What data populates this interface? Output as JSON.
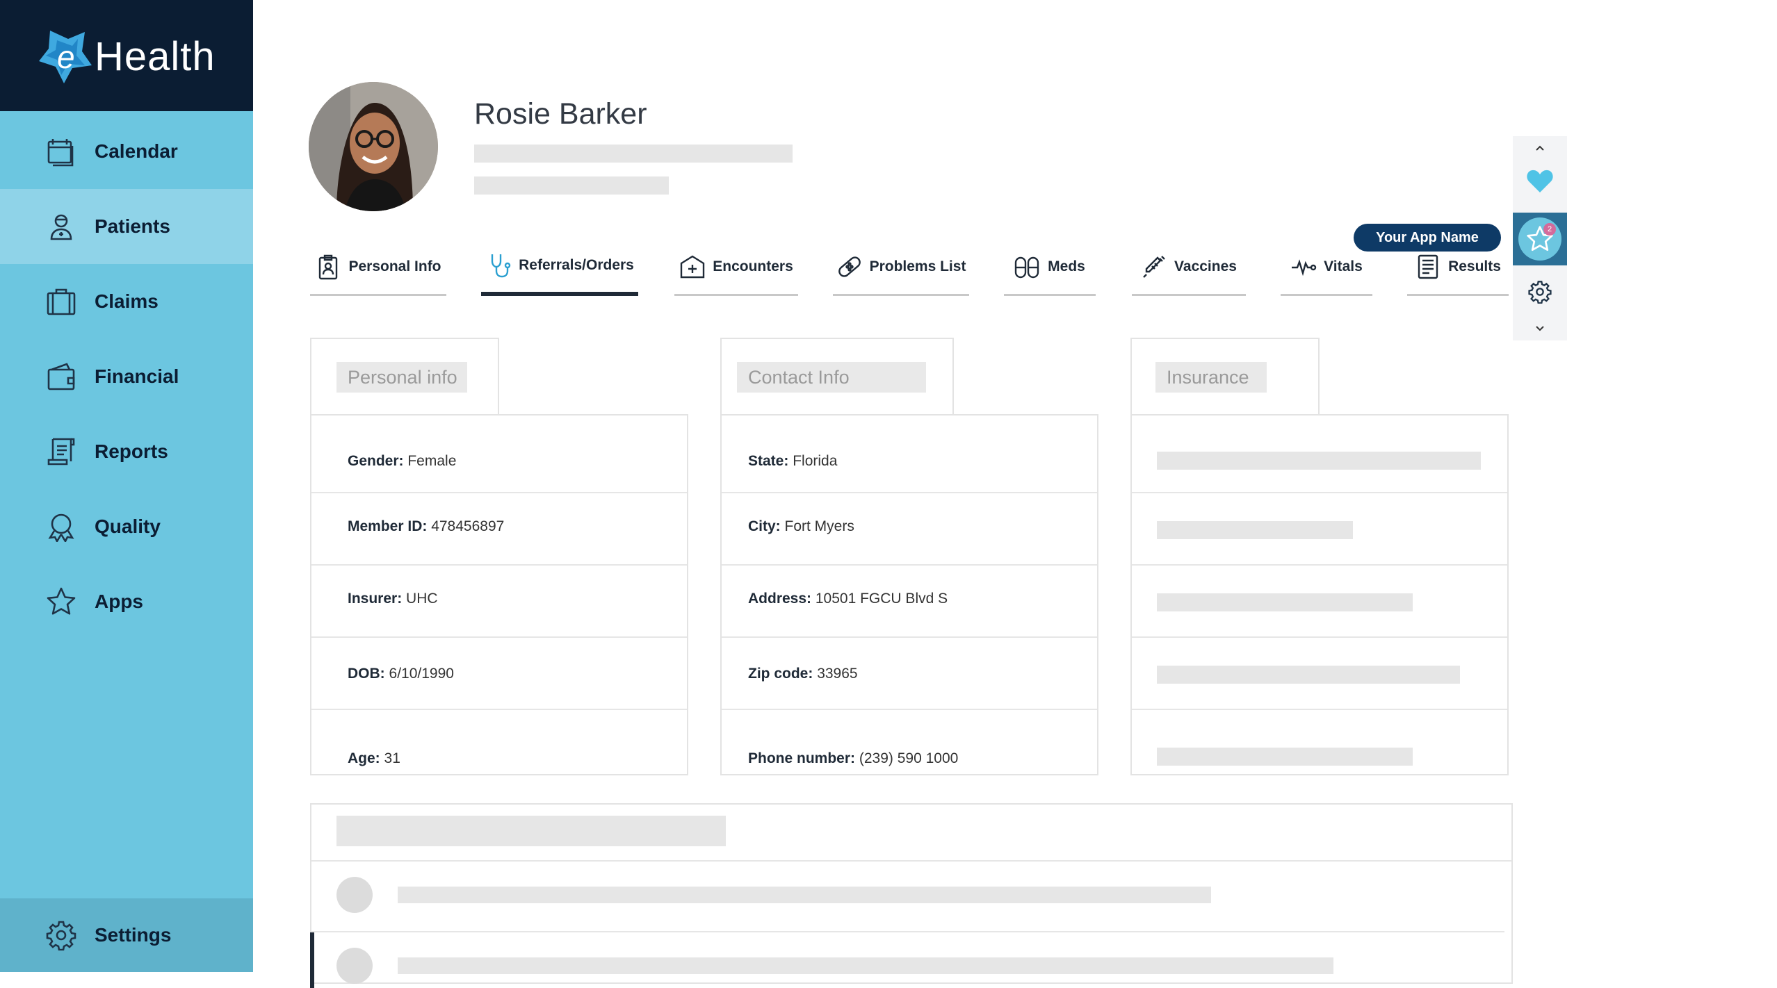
{
  "brand": {
    "logo_letter": "e",
    "name": "Health"
  },
  "sidebar": {
    "items": [
      {
        "label": "Calendar",
        "icon": "calendar-icon"
      },
      {
        "label": "Patients",
        "icon": "patient-icon",
        "active": true
      },
      {
        "label": "Claims",
        "icon": "briefcase-icon"
      },
      {
        "label": "Financial",
        "icon": "wallet-icon"
      },
      {
        "label": "Reports",
        "icon": "report-icon"
      },
      {
        "label": "Quality",
        "icon": "award-icon"
      },
      {
        "label": "Apps",
        "icon": "star-icon"
      }
    ],
    "settings": {
      "label": "Settings",
      "icon": "gear-icon"
    }
  },
  "patient": {
    "name": "Rosie Barker"
  },
  "tabs": [
    {
      "label": "Personal Info",
      "icon": "id-badge-icon"
    },
    {
      "label": "Referrals/Orders",
      "icon": "stethoscope-icon",
      "active": true
    },
    {
      "label": "Encounters",
      "icon": "medical-case-icon"
    },
    {
      "label": "Problems List",
      "icon": "bandage-icon"
    },
    {
      "label": "Meds",
      "icon": "pills-icon"
    },
    {
      "label": "Vaccines",
      "icon": "syringe-icon"
    },
    {
      "label": "Vitals",
      "icon": "pulse-icon"
    },
    {
      "label": "Results",
      "icon": "document-icon"
    }
  ],
  "app_badge": "Your App Name",
  "mini_toolbar": {
    "notification_count": "2"
  },
  "cards": {
    "personal": {
      "title": "Personal info",
      "rows": [
        {
          "label": "Gender:",
          "value": "Female"
        },
        {
          "label": "Member ID:",
          "value": "478456897"
        },
        {
          "label": "Insurer:",
          "value": "UHC"
        },
        {
          "label": "DOB:",
          "value": "6/10/1990"
        },
        {
          "label": "Age:",
          "value": "31"
        }
      ]
    },
    "contact": {
      "title": "Contact Info",
      "rows": [
        {
          "label": "State:",
          "value": "Florida"
        },
        {
          "label": "City:",
          "value": "Fort Myers"
        },
        {
          "label": "Address:",
          "value": "10501 FGCU Blvd S"
        },
        {
          "label": "Zip code:",
          "value": "33965"
        },
        {
          "label": "Phone number:",
          "value": "(239) 590 1000"
        }
      ]
    },
    "insurance": {
      "title": "Insurance"
    }
  },
  "colors": {
    "sidebar": "#6cc6e0",
    "logo_bar": "#0b1d33",
    "active_nav": "#8fd3e8",
    "badge": "#0e3a66",
    "heart": "#4fc3e6"
  }
}
